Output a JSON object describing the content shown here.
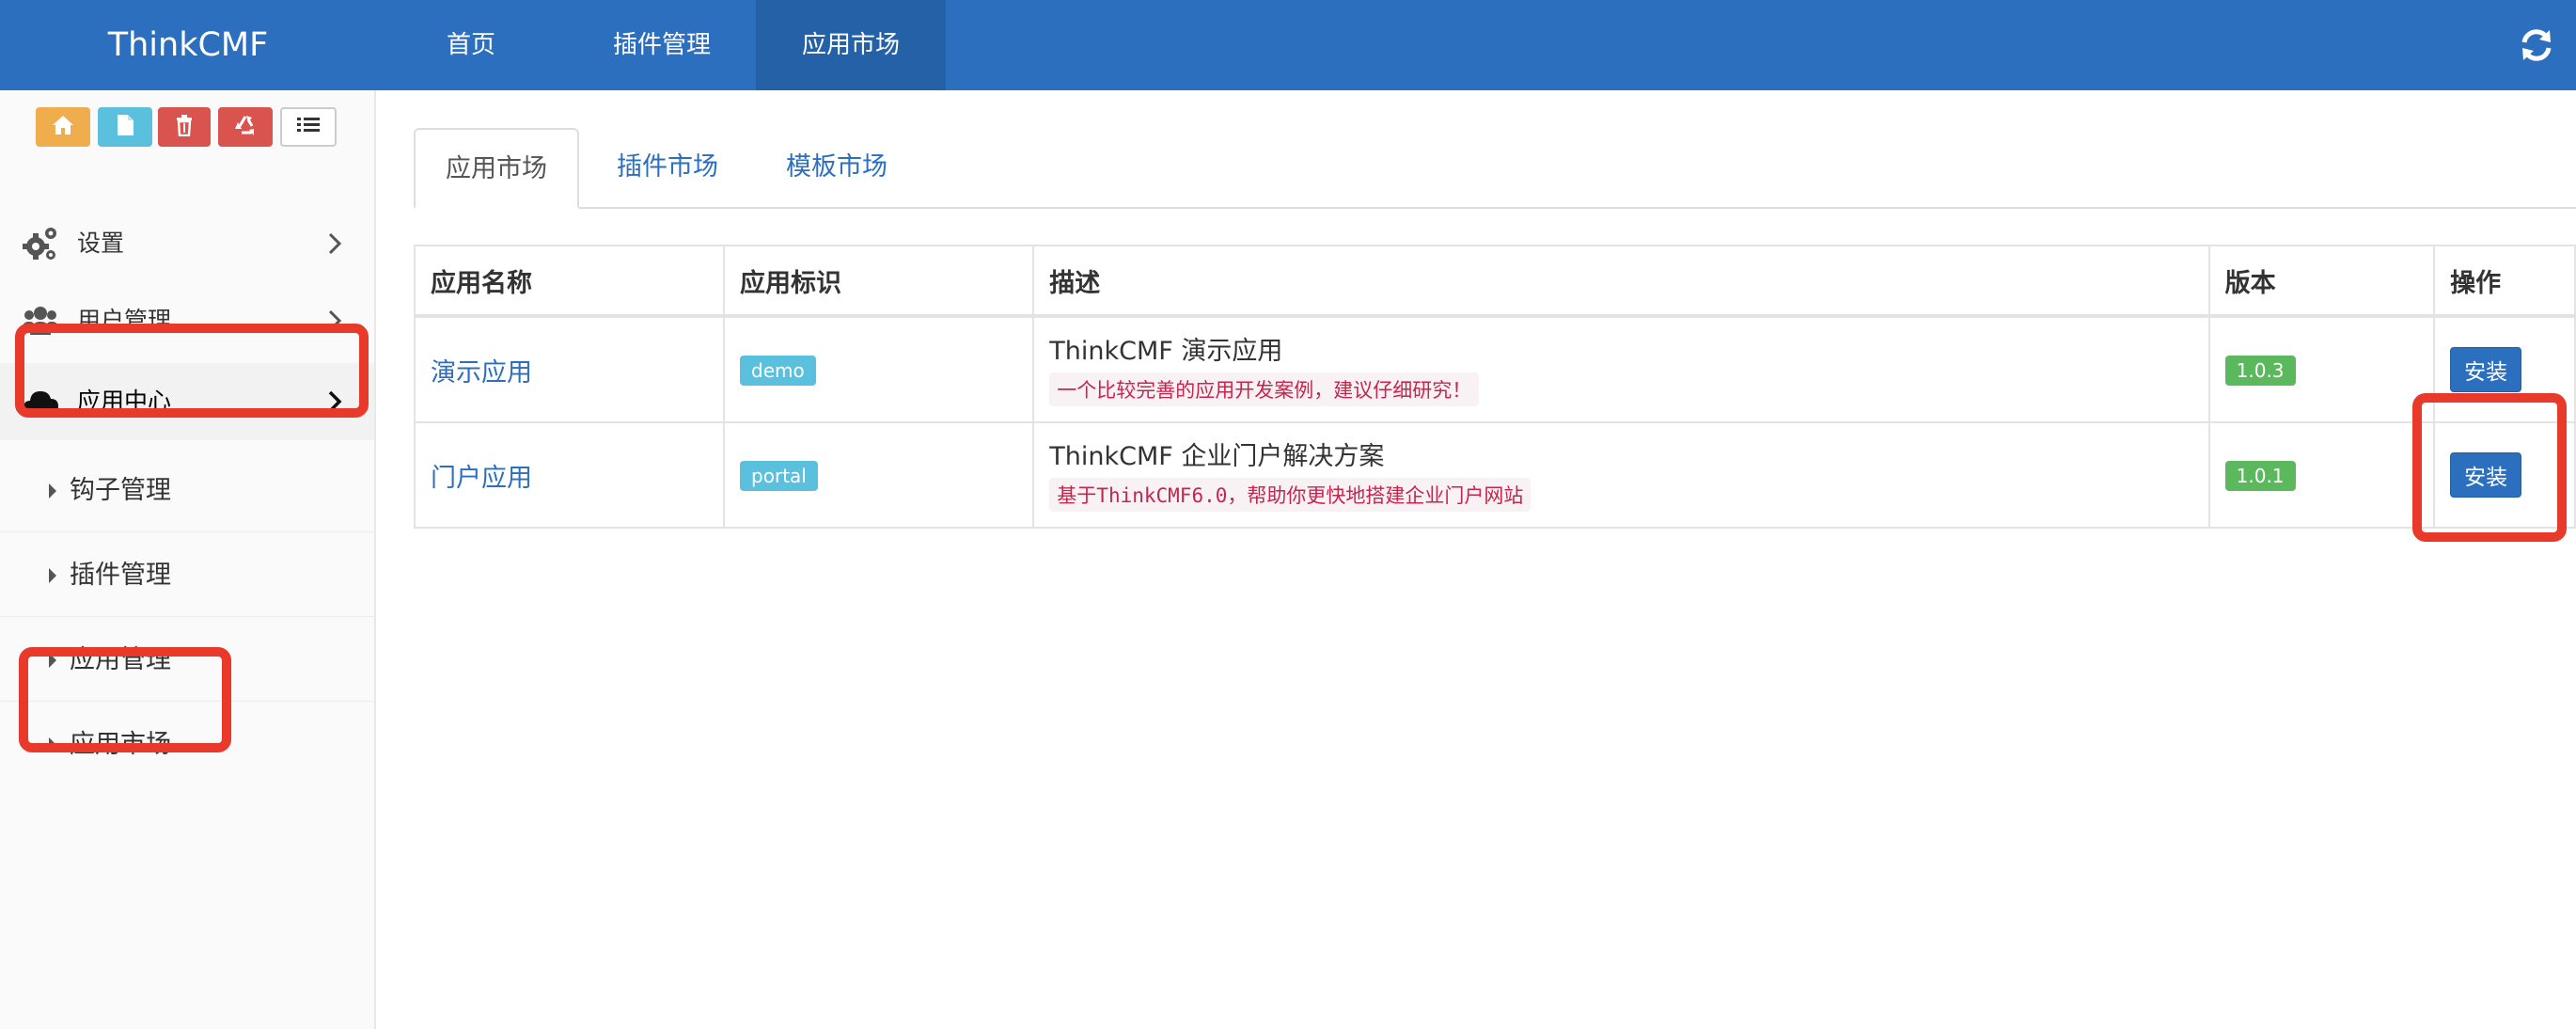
{
  "header": {
    "brand": "ThinkCMF",
    "nav": [
      {
        "label": "首页"
      },
      {
        "label": "插件管理"
      },
      {
        "label": "应用市场"
      }
    ]
  },
  "shortcuts": [
    {
      "icon": "home-icon",
      "color": "#f0ad4e"
    },
    {
      "icon": "file-icon",
      "color": "#5bc0de"
    },
    {
      "icon": "trash-icon",
      "color": "#d9534f"
    },
    {
      "icon": "recycle-icon",
      "color": "#d9534f"
    },
    {
      "icon": "list-icon",
      "color": "#ffffff"
    }
  ],
  "sidebar": {
    "items": [
      {
        "label": "设置",
        "icon": "gears-icon"
      },
      {
        "label": "用户管理",
        "icon": "users-icon"
      },
      {
        "label": "应用中心",
        "icon": "cloud-icon"
      }
    ],
    "subitems": [
      {
        "label": "钩子管理"
      },
      {
        "label": "插件管理"
      },
      {
        "label": "应用管理"
      },
      {
        "label": "应用市场"
      }
    ]
  },
  "tabs": [
    {
      "label": "应用市场"
    },
    {
      "label": "插件市场"
    },
    {
      "label": "模板市场"
    }
  ],
  "table": {
    "headers": [
      "应用名称",
      "应用标识",
      "描述",
      "版本",
      "操作"
    ],
    "rows": [
      {
        "name": "演示应用",
        "id": "demo",
        "desc_title": "ThinkCMF 演示应用",
        "desc_sub": "一个比较完善的应用开发案例，建议仔细研究！",
        "version": "1.0.3",
        "action": "安装"
      },
      {
        "name": "门户应用",
        "id": "portal",
        "desc_title": "ThinkCMF 企业门户解决方案",
        "desc_sub": "基于ThinkCMF6.0，帮助你更快地搭建企业门户网站",
        "version": "1.0.1",
        "action": "安装"
      }
    ]
  },
  "colors": {
    "navbar": "#2c6fbe",
    "highlight": "#e8392a",
    "link": "#2c6fbe"
  }
}
